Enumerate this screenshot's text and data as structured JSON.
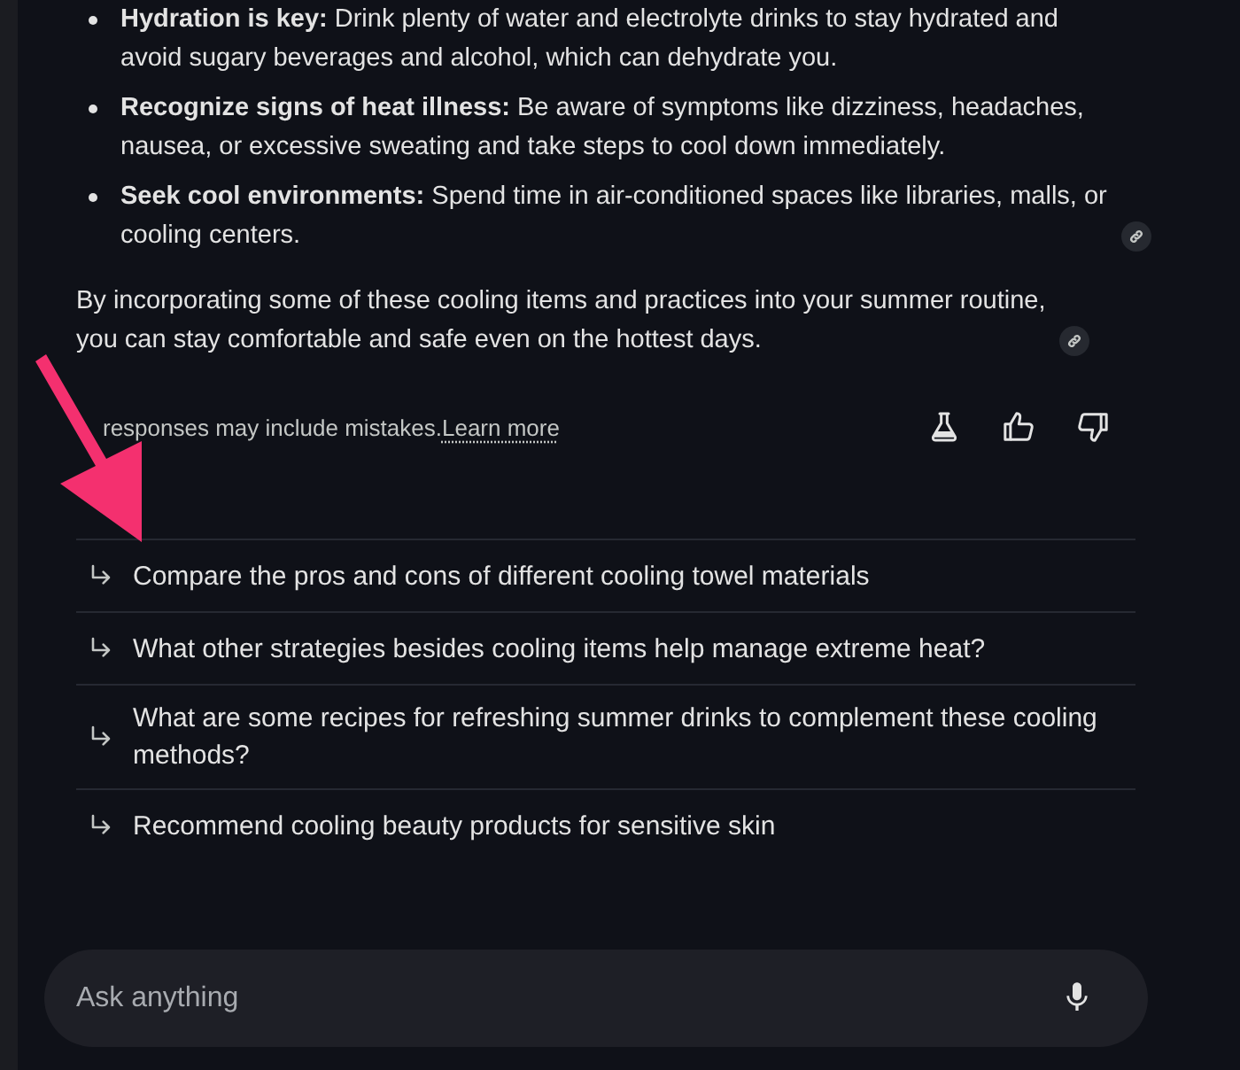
{
  "answer": {
    "bullets": [
      {
        "text": "**Hydration is key:** Drink plenty of water and electrolyte drinks to stay hydrated and avoid sugary beverages and alcohol, which can dehydrate you.",
        "source_link": false
      },
      {
        "text": "**Recognize signs of heat illness:** Be aware of symptoms like dizziness, headaches, nausea, or excessive sweating and take steps to cool down immediately.",
        "source_link": false
      },
      {
        "text": "**Seek cool environments:** Spend time in air-conditioned spaces like libraries, malls, or cooling centers.",
        "source_link": true
      }
    ],
    "summary": {
      "text": "By incorporating some of these cooling items and practices into your summer routine, you can stay comfortable and safe even on the hottest days.",
      "source_link": true
    }
  },
  "disclaimer": {
    "text": "responses may include mistakes.",
    "link": "Learn more"
  },
  "suggestions": [
    {
      "text": "Compare the pros and cons of different cooling towel materials"
    },
    {
      "text": "What other strategies besides cooling items help manage extreme heat?"
    },
    {
      "text": "What are some recipes for refreshing summer drinks to complement these cooling methods?"
    },
    {
      "text": "Recommend cooling beauty products for sensitive skin"
    }
  ],
  "ask_bar": {
    "placeholder": "Ask anything"
  }
}
